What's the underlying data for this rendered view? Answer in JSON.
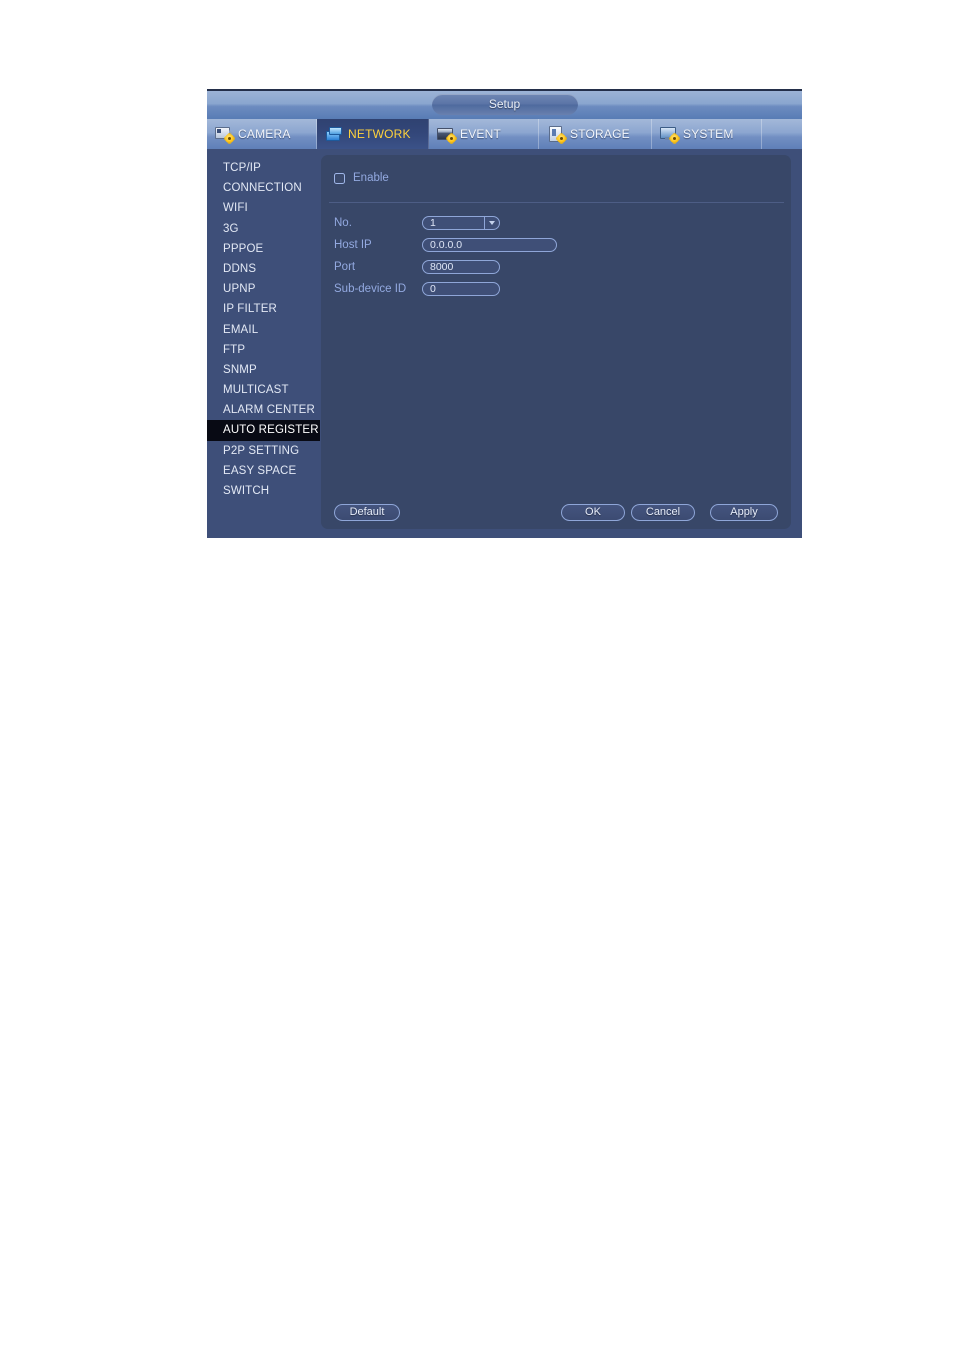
{
  "window": {
    "title": "Setup"
  },
  "tabs": [
    {
      "label": "CAMERA",
      "icon": "camera-gear-icon",
      "active": false
    },
    {
      "label": "NETWORK",
      "icon": "network-gear-icon",
      "active": true
    },
    {
      "label": "EVENT",
      "icon": "event-gear-icon",
      "active": false
    },
    {
      "label": "STORAGE",
      "icon": "storage-gear-icon",
      "active": false
    },
    {
      "label": "SYSTEM",
      "icon": "system-gear-icon",
      "active": false
    }
  ],
  "sidebar": {
    "items": [
      {
        "label": "TCP/IP",
        "active": false
      },
      {
        "label": "CONNECTION",
        "active": false
      },
      {
        "label": "WIFI",
        "active": false
      },
      {
        "label": "3G",
        "active": false
      },
      {
        "label": "PPPOE",
        "active": false
      },
      {
        "label": "DDNS",
        "active": false
      },
      {
        "label": "UPNP",
        "active": false
      },
      {
        "label": "IP FILTER",
        "active": false
      },
      {
        "label": "EMAIL",
        "active": false
      },
      {
        "label": "FTP",
        "active": false
      },
      {
        "label": "SNMP",
        "active": false
      },
      {
        "label": "MULTICAST",
        "active": false
      },
      {
        "label": "ALARM CENTER",
        "active": false
      },
      {
        "label": "AUTO REGISTER",
        "active": true
      },
      {
        "label": "P2P SETTING",
        "active": false
      },
      {
        "label": "EASY SPACE",
        "active": false
      },
      {
        "label": "SWITCH",
        "active": false
      }
    ]
  },
  "form": {
    "enable_label": "Enable",
    "enable_checked": false,
    "no_label": "No.",
    "no_value": "1",
    "host_ip_label": "Host IP",
    "host_ip_value": "0.0.0.0",
    "port_label": "Port",
    "port_value": "8000",
    "sub_device_label": "Sub-device ID",
    "sub_device_value": "0"
  },
  "buttons": {
    "default": "Default",
    "ok": "OK",
    "cancel": "Cancel",
    "apply": "Apply"
  },
  "colors": {
    "window_bg": "#3e4f79",
    "content_bg": "#384768",
    "label_blue": "#93a9e0",
    "active_tab_text": "#ffd23c",
    "active_item_bg": "#080a14",
    "gear_yellow": "#ffc516"
  }
}
